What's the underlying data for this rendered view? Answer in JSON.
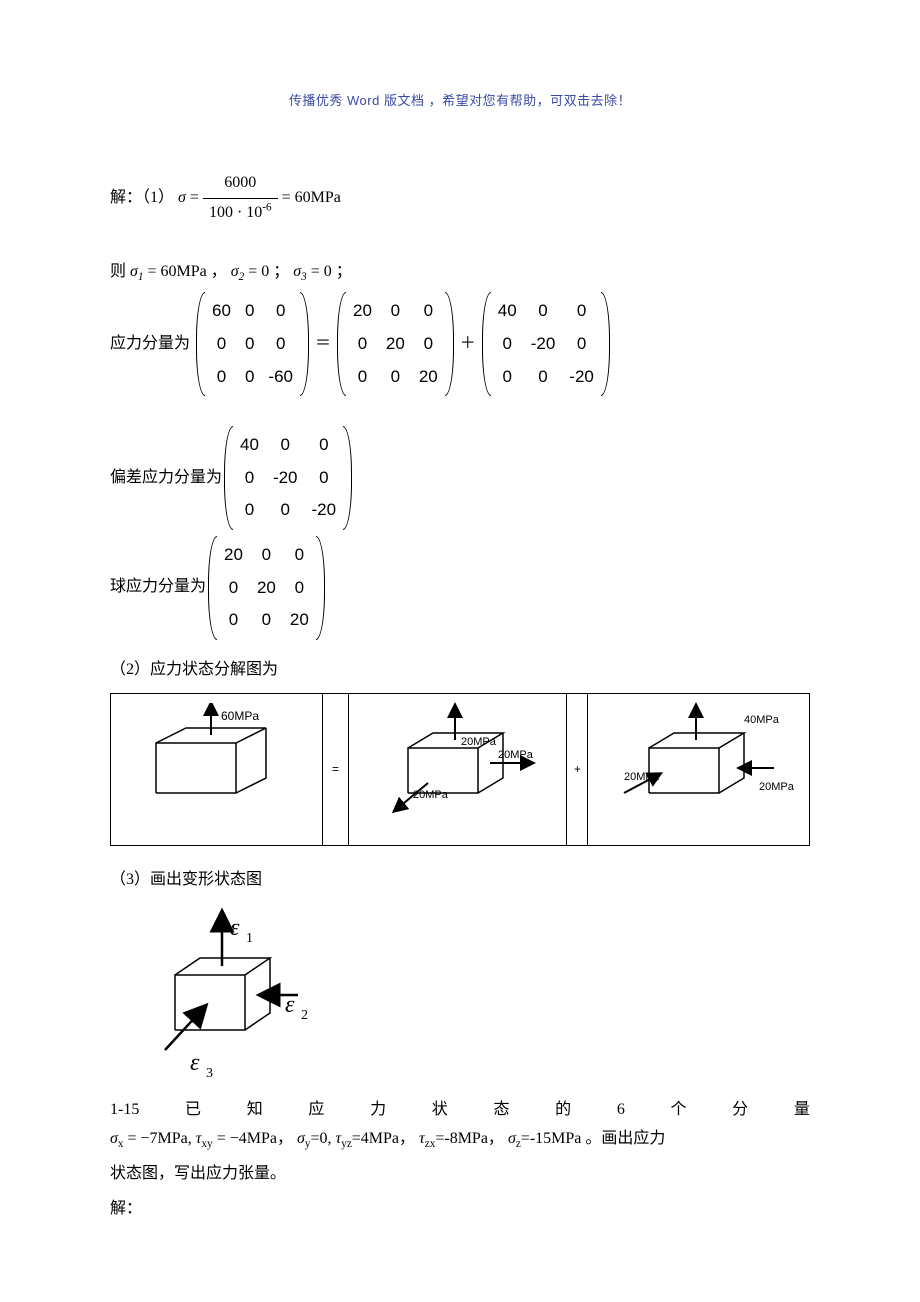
{
  "header": "传播优秀 Word 版文档 ，希望对您有帮助，可双击去除！",
  "line1_prefix": "解：（1）",
  "sigma_eq": {
    "num": "6000",
    "den_a": "100",
    "den_b": "10",
    "den_exp": "-6",
    "result": "60",
    "unit": "MPa"
  },
  "line2_prefix": "则",
  "sigma1_a": "σ",
  "sigma1_sub": "1",
  "sigma1_val": " = 60MPa ，",
  "sigma2_a": "σ",
  "sigma2_sub": "2",
  "sigma2_val": " = 0 ；",
  "sigma3_a": "σ",
  "sigma3_sub": "3",
  "sigma3_val": " = 0 ；",
  "label_stress": "应力分量为",
  "mat_full": [
    "60",
    "0",
    "0",
    "0",
    "0",
    "0",
    "0",
    "0",
    "-60"
  ],
  "eq_sym": "＝",
  "mat_sph": [
    "20",
    "0",
    "0",
    "0",
    "20",
    "0",
    "0",
    "0",
    "20"
  ],
  "plus_sym": "＋",
  "mat_dev": [
    "40",
    "0",
    "0",
    "0",
    "-20",
    "0",
    "0",
    "0",
    "-20"
  ],
  "label_dev": "偏差应力分量为",
  "mat_dev2": [
    "40",
    "0",
    "0",
    "0",
    "-20",
    "0",
    "0",
    "0",
    "-20"
  ],
  "label_sph": "球应力分量为",
  "mat_sph2": [
    "20",
    "0",
    "0",
    "0",
    "20",
    "0",
    "0",
    "0",
    "20"
  ],
  "label_partA": "（2）应力状态分解图为",
  "cube1_lbl": "60MPa",
  "cube2_lbls": [
    "20MPa",
    "20MPa",
    "20MPa"
  ],
  "cube3_lbls": [
    "40MPa",
    "20MPa",
    "20MPa"
  ],
  "decomp_eq": "=",
  "decomp_plus": "+",
  "label_partB": "（3）画出变形状态图",
  "eps1": "ε",
  "eps1_sub": "1",
  "eps2": "ε",
  "eps2_sub": "2",
  "eps3": "ε",
  "eps3_sub": "3",
  "prob_no": "1-15",
  "prob_words": [
    "已",
    "知",
    "应",
    "力",
    "状",
    "态",
    "的",
    "6",
    "个",
    "分",
    "量"
  ],
  "given1_sx": "σ",
  "given1_sx_sub": "x",
  "given1_sx_val": " = −7MPa, ",
  "given1_txy": "τ",
  "given1_txy_sub": "xy",
  "given1_txy_val": " = −4MPa，",
  "given1_sy": "σ",
  "given1_sy_sub": "y",
  "given1_sy_val": "=0, ",
  "given1_tyz": "τ",
  "given1_tyz_sub": "yz",
  "given1_tyz_val": "=4MPa，",
  "given1_tzx": "τ",
  "given1_tzx_sub": "zx",
  "given1_tzx_val": "=-8MPa，",
  "given1_sz": "σ",
  "given1_sz_sub": "z",
  "given1_sz_val": "=-15MPa 。画出应力",
  "last_line": "状态图，写出应力张量。",
  "ans_label": "解："
}
